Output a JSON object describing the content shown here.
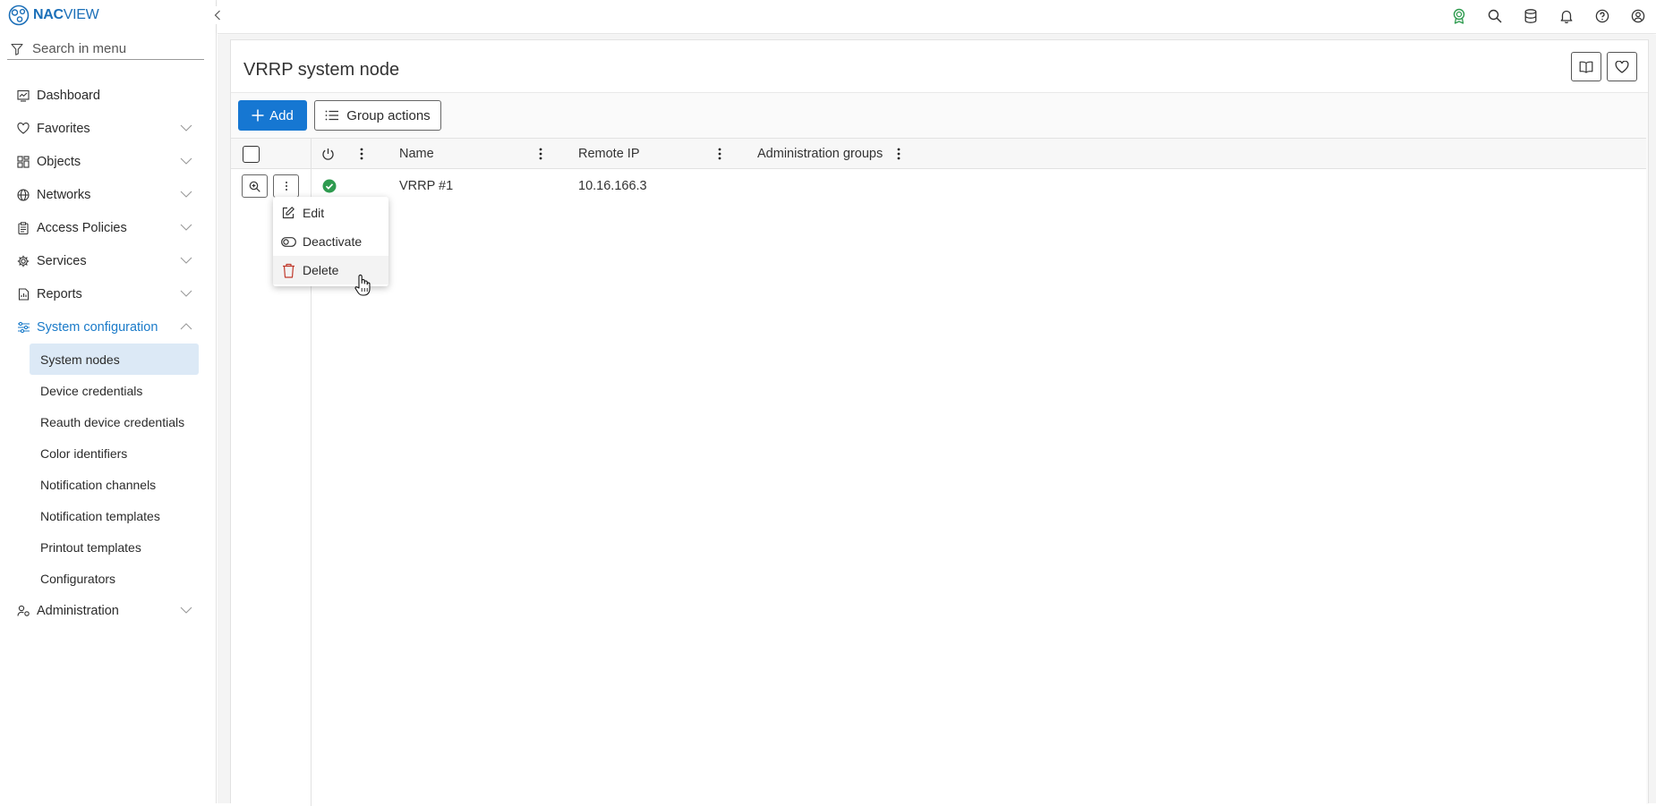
{
  "app": {
    "logo_brand": "NAC",
    "logo_suffix": "VIEW"
  },
  "sidebar": {
    "search_placeholder": "Search in menu",
    "items": [
      {
        "label": "Dashboard",
        "icon": "dashboard-icon"
      },
      {
        "label": "Favorites",
        "icon": "heart-icon"
      },
      {
        "label": "Objects",
        "icon": "objects-icon"
      },
      {
        "label": "Networks",
        "icon": "globe-icon"
      },
      {
        "label": "Access Policies",
        "icon": "clipboard-icon"
      },
      {
        "label": "Services",
        "icon": "gear-icon"
      },
      {
        "label": "Reports",
        "icon": "report-icon"
      },
      {
        "label": "System configuration",
        "icon": "sliders-icon"
      },
      {
        "label": "Administration",
        "icon": "users-gear-icon"
      }
    ],
    "system_configuration_children": [
      "System nodes",
      "Device credentials",
      "Reauth device credentials",
      "Color identifiers",
      "Notification channels",
      "Notification templates",
      "Printout templates",
      "Configurators"
    ]
  },
  "topbar": {
    "icons": [
      "award-icon",
      "search-icon",
      "database-icon",
      "bell-icon",
      "help-icon",
      "user-icon"
    ],
    "accent_award": "#2e9b4f"
  },
  "page": {
    "title": "VRRP system node",
    "add_label": "Add",
    "group_actions_label": "Group actions"
  },
  "table": {
    "columns": [
      "Name",
      "Remote IP",
      "Administration groups"
    ],
    "rows": [
      {
        "status": "active",
        "name": "VRRP #1",
        "remote_ip": "10.16.166.3"
      }
    ]
  },
  "context_menu": {
    "items": [
      "Edit",
      "Deactivate",
      "Delete"
    ]
  },
  "colors": {
    "primary": "#1677d2",
    "active_nav": "#1b7bc9",
    "selected_bg": "#dce9f6",
    "status_ok": "#2e9b4f",
    "delete_red": "#c0392b"
  }
}
